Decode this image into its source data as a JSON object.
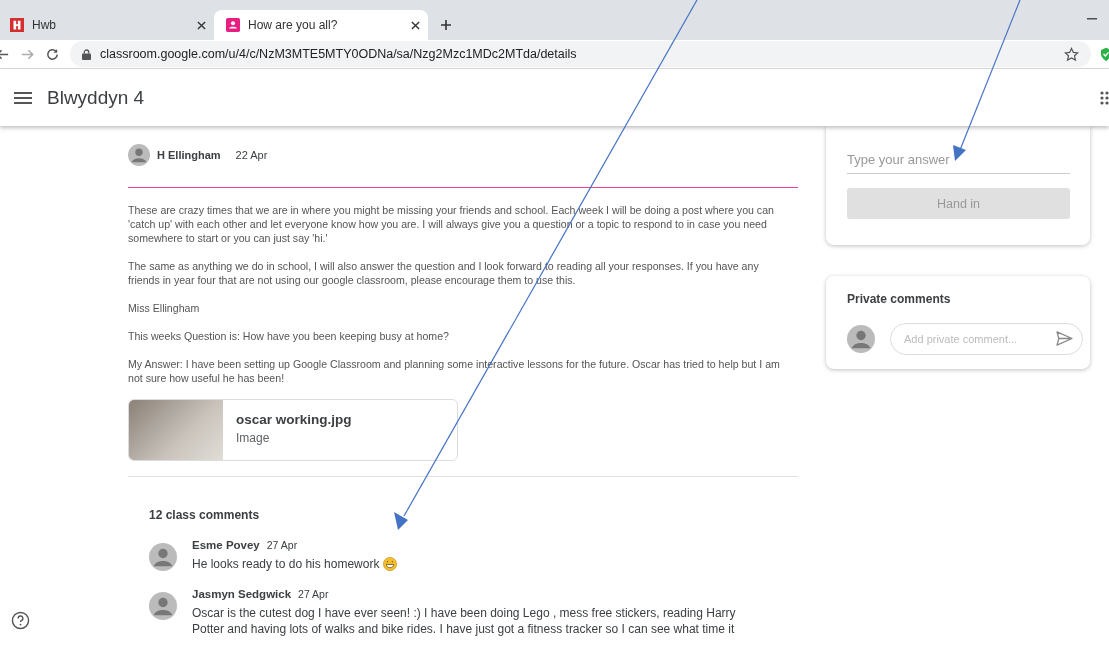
{
  "browser": {
    "tabs": [
      {
        "title": "Hwb",
        "kind": "letter",
        "selected": false
      },
      {
        "title": "How are you all?",
        "kind": "person",
        "selected": true
      }
    ],
    "url": "classroom.google.com/u/4/c/NzM3MTE5MTY0ODNa/sa/Nzg2Mzc1MDc2MTda/details"
  },
  "header": {
    "title": "Blwyddyn 4"
  },
  "post": {
    "author": "H Ellingham",
    "date": "22 Apr",
    "paragraphs": [
      "These are crazy times that we are in where you might be missing your friends and school. Each week I will be doing a post where you can 'catch up' with each other and let everyone know how you are. I will always give you a question or a topic to respond to in case you need somewhere to start or you can just say 'hi.'",
      "The same as anything we do in school, I will also answer the question and I look forward to reading all your responses. If you have any friends in year four that are not using our google classroom, please encourage them to use this.",
      "Miss Ellingham",
      "This weeks Question is: How have you been keeping busy at home?",
      "My Answer: I have been setting up Google Classroom and planning some interactive lessons for the future. Oscar has tried to help but I am not sure how useful he has been!"
    ],
    "attachment": {
      "name": "oscar working.jpg",
      "type": "Image"
    }
  },
  "comments": {
    "count": "12 class comments",
    "items": [
      {
        "author": "Esme Povey",
        "date": "27 Apr",
        "text": "He looks ready to do his homework",
        "emoji": true
      },
      {
        "author": "Jasmyn Sedgwick",
        "date": "27 Apr",
        "text": "Oscar is the cutest dog I have ever seen! :) I have been doing Lego , mess free stickers, reading Harry Potter and having lots of walks and bike rides. I have just got a fitness tracker so I can see what time it",
        "emoji": false
      }
    ]
  },
  "work": {
    "answer_placeholder": "Type your answer",
    "hand_in": {
      "label": "Hand in",
      "disabled": true
    }
  },
  "private": {
    "title": "Private comments",
    "placeholder": "Add private comment..."
  }
}
